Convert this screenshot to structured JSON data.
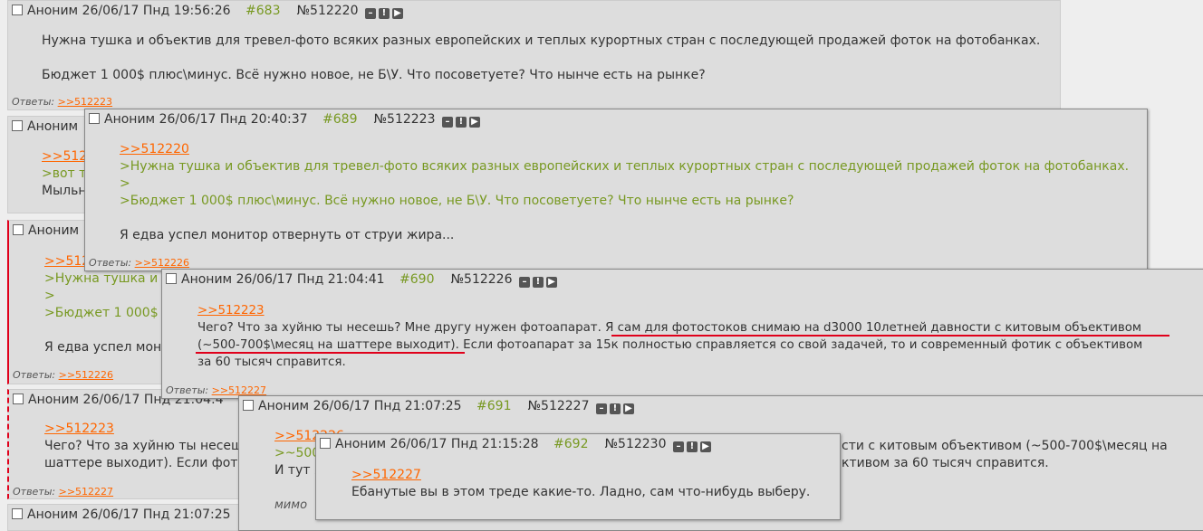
{
  "answers_label": "Ответы:",
  "post_683": {
    "name": "Аноним",
    "date": "26/06/17 Пнд 19:56:26",
    "num": "#683",
    "id": "№512220",
    "lines": [
      "Нужна тушка и объектив для тревел-фото всяких разных европейских и теплых курортных стран с последующей продажей фоток на фотобанках.",
      "Бюджет 1 000$ плюс\\минус. Всё нужно новое, не Б\\У. Что посоветуете? Что нынче есть на рынке?"
    ],
    "reply": ">>512223"
  },
  "bg_689": {
    "header": "Аноним",
    "lines": [
      ">>512",
      ">вот т",
      "Мыльн"
    ]
  },
  "bg_689_left": {
    "header": "Аноним",
    "lines": [
      ">>512",
      ">Нужна тушка и о",
      ">",
      ">Бюджет 1 000$",
      "Я едва успел мон"
    ],
    "reply": ">>512226"
  },
  "bg_690_left": {
    "header": "Аноним 26/06/17 Пнд 21:04:4",
    "link": ">>512223",
    "l1": "Чего? Что за хуйню ты несеш",
    "l2": "шаттере выходит). Если фото",
    "reply": ">>512227"
  },
  "bg_691_left": {
    "header": "Аноним 26/06/17 Пнд 21:07:25"
  },
  "post_689": {
    "name": "Аноним",
    "date": "26/06/17 Пнд 20:40:37",
    "num": "#689",
    "id": "№512223",
    "link": ">>512220",
    "q1": ">Нужна тушка и объектив для тревел-фото всяких разных европейских и теплых курортных стран с последующей продажей фоток на фотобанках.",
    "q2": ">",
    "q3": ">Бюджет 1 000$ плюс\\минус. Всё нужно новое, не Б\\У. Что посоветуете? Что нынче есть на рынке?",
    "text": "Я едва успел монитор отвернуть от струи жира...",
    "reply": ">>512226"
  },
  "post_690": {
    "name": "Аноним",
    "date": "26/06/17 Пнд 21:04:41",
    "num": "#690",
    "id": "№512226",
    "link": ">>512223",
    "l1": "Чего? Что за хуйню ты несешь? Мне другу нужен фотоапарат. Я сам для фотостоков снимаю на d3000 10летней давности с китовым объективом",
    "l2": "(~500-700$\\месяц на шаттере выходит). Если фотоапарат за 15к полностью справляется со свой задачей, то и современный фотик с объективом",
    "l3": "за 60 тысяч справится.",
    "reply": ">>512227"
  },
  "post_691": {
    "name": "Аноним",
    "date": "26/06/17 Пнд 21:07:25",
    "num": "#691",
    "id": "№512227",
    "link": ">>512226",
    "q1": ">~500",
    "t1": "И тут я",
    "right1": "сти с китовым объективом (~500-700$\\месяц на",
    "right2": "ктивом за 60 тысяч справится.",
    "mimo": "мимо"
  },
  "post_692": {
    "name": "Аноним",
    "date": "26/06/17 Пнд 21:15:28",
    "num": "#692",
    "id": "№512230",
    "link": ">>512227",
    "text": "Ебанутые вы в этом треде какие-то. Ладно, сам что-нибудь выберу."
  },
  "colors": {
    "link": "#ff6600",
    "quote": "#789922",
    "post_bg": "#dddddd",
    "underline": "#e0001b"
  }
}
